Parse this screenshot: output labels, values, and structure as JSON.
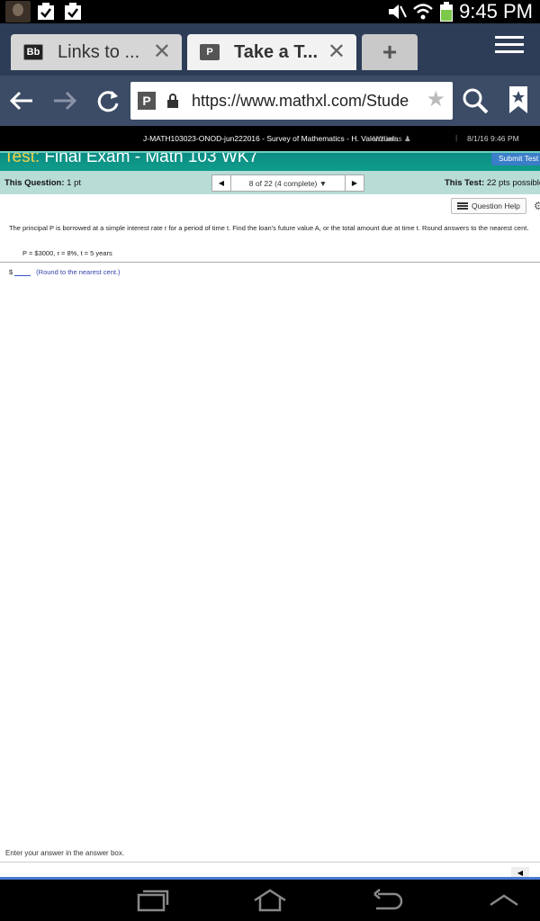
{
  "status_bar": {
    "time": "9:45 PM"
  },
  "tabs": [
    {
      "label": "Links to ...",
      "favicon": "Bb"
    },
    {
      "label": "Take a T...",
      "favicon": "P"
    }
  ],
  "address_bar": {
    "url": "https://www.mathxl.com/Stude",
    "site_icon": "P"
  },
  "header": {
    "course": "J-MATH103023-ONOD-jun222016 - Survey of Mathematics - H. Valenzuela",
    "user": "Williams",
    "datetime": "8/1/16 9:46 PM"
  },
  "test": {
    "title_lead": "Test:",
    "title_rest": " Final Exam - Math 103 WK7",
    "submit_label": "Submit Test"
  },
  "question_bar": {
    "this_question_label": "This Question:",
    "this_question_value": "1 pt",
    "pager_text": "8 of 22 (4 complete)",
    "this_test_label": "This Test:",
    "this_test_value": "22 pts possible"
  },
  "help_label": "Question Help",
  "question": {
    "prompt": "The principal P is borrowed at a simple interest rate r for a period of time t. Find the loan's future value A, or the total amount due at time t. Round answers to the nearest cent.",
    "given": "P = $3000, r = 8%, t = 5 years",
    "answer_prefix": "$",
    "answer_hint": "(Round to the nearest cent.)"
  },
  "footer": {
    "instruction": "Enter your answer in the answer box."
  },
  "colors": {
    "accent": "#0f9c8a",
    "title_lead": "#f2d24a",
    "question_bar": "#b8dcd6"
  }
}
